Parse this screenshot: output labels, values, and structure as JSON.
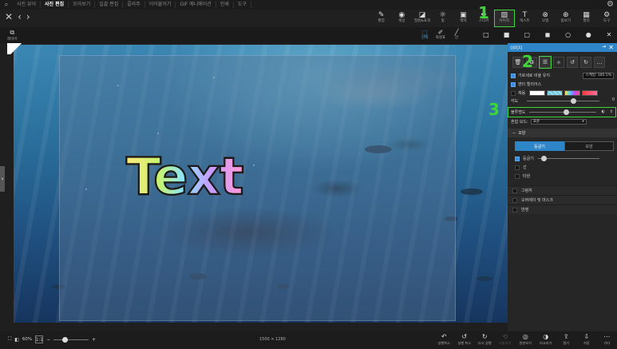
{
  "menu": {
    "logo_icon": "search-icon",
    "items": [
      "사진 뷰어",
      "사진 편집",
      "모아보기",
      "일괄 편집",
      "콜라주",
      "이어붙이기",
      "GIF 애니메이션",
      "인쇄",
      "도구"
    ],
    "active": "사진 편집"
  },
  "nav": {
    "close": "✕",
    "back": "‹",
    "forward": "›"
  },
  "toolbar": {
    "items": [
      {
        "label": "편집",
        "icon": "edit-icon",
        "glyph": "✎"
      },
      {
        "label": "색상",
        "icon": "color-icon",
        "glyph": "◉"
      },
      {
        "label": "필름&효과",
        "icon": "filter-icon",
        "glyph": "◪"
      },
      {
        "label": "빛",
        "icon": "light-icon",
        "glyph": "☼"
      },
      {
        "label": "액자",
        "icon": "frame-icon",
        "glyph": "▣"
      },
      {
        "label": "스티커",
        "icon": "sticker-icon",
        "glyph": "❖"
      },
      {
        "label": "이미지",
        "icon": "image-icon",
        "glyph": "▨"
      },
      {
        "label": "텍스트",
        "icon": "text-icon",
        "glyph": "T"
      },
      {
        "label": "모형",
        "icon": "shape-icon",
        "glyph": "⊗"
      },
      {
        "label": "돋보기",
        "icon": "magnifier-icon",
        "glyph": "⊕"
      },
      {
        "label": "필터",
        "icon": "pattern-icon",
        "glyph": "▦"
      },
      {
        "label": "도구",
        "icon": "tools-icon",
        "glyph": "⚙"
      }
    ],
    "selected_index": 6
  },
  "subbar": {
    "layer_label": "레이어",
    "tools": [
      {
        "label": "선택",
        "icon": "select-icon",
        "glyph": "⬚",
        "selected": true
      },
      {
        "label": "화살표",
        "icon": "pen-icon",
        "glyph": "✐",
        "selected": false
      },
      {
        "label": "선",
        "icon": "line-icon",
        "glyph": "╱",
        "selected": false
      }
    ],
    "shapes": [
      "□",
      "■",
      "▢",
      "◼",
      "○",
      "●",
      "✕"
    ]
  },
  "canvas": {
    "text_layer": "Text",
    "expand_icon": "›"
  },
  "panel": {
    "title": "이미지",
    "pin_glyph": "⇥",
    "close_glyph": "✕",
    "icons": [
      "🗑",
      "⧉",
      "☰",
      "◆",
      "↺",
      "↻",
      "…"
    ],
    "row_keep_ratio": "가로세로 비율 유지",
    "scale_label": "스케일: 185.5%",
    "row_edge_mask": "엔티 엘리어스",
    "fill_label": "채움",
    "slider_label": "각도",
    "slider_value": "0",
    "slider_value_pos": 0.65,
    "opacity_label": "불투명도",
    "opacity_pos": 0.55,
    "blend_label": "혼합 모드:",
    "blend_value": "표준",
    "section_shape": "모양",
    "seg_on": "둥글기",
    "seg_off": "모양",
    "round_label": "둥글기",
    "round_pos": 0.05,
    "line_label": "선",
    "gradient_label": "타원",
    "layer_rows": [
      "그림자",
      "오버레이 및 마스크",
      "반영"
    ]
  },
  "bottom": {
    "zoom": "60%",
    "zoom_box": "1:1",
    "dims": "1500 × 1280",
    "zoom_pos": 0.28,
    "buttons": [
      {
        "label": "실행취소",
        "glyph": "↶",
        "dim": false
      },
      {
        "label": "실행 취소",
        "glyph": "↺",
        "dim": false
      },
      {
        "label": "다시 실행",
        "glyph": "↻",
        "dim": false
      },
      {
        "label": "되돌리기",
        "glyph": "⟲",
        "dim": true
      },
      {
        "label": "원본보기",
        "glyph": "◎",
        "dim": false
      },
      {
        "label": "비교하기",
        "glyph": "◑",
        "dim": false
      },
      {
        "label": "열기",
        "glyph": "⇪",
        "dim": false
      },
      {
        "label": "저장",
        "glyph": "⇩",
        "dim": false
      },
      {
        "label": "기타",
        "glyph": "⋯",
        "dim": false
      }
    ]
  },
  "annotations": [
    "1",
    "2",
    "3"
  ],
  "colors": {
    "accent": "#2e86c8",
    "highlight": "#3fd43a"
  }
}
